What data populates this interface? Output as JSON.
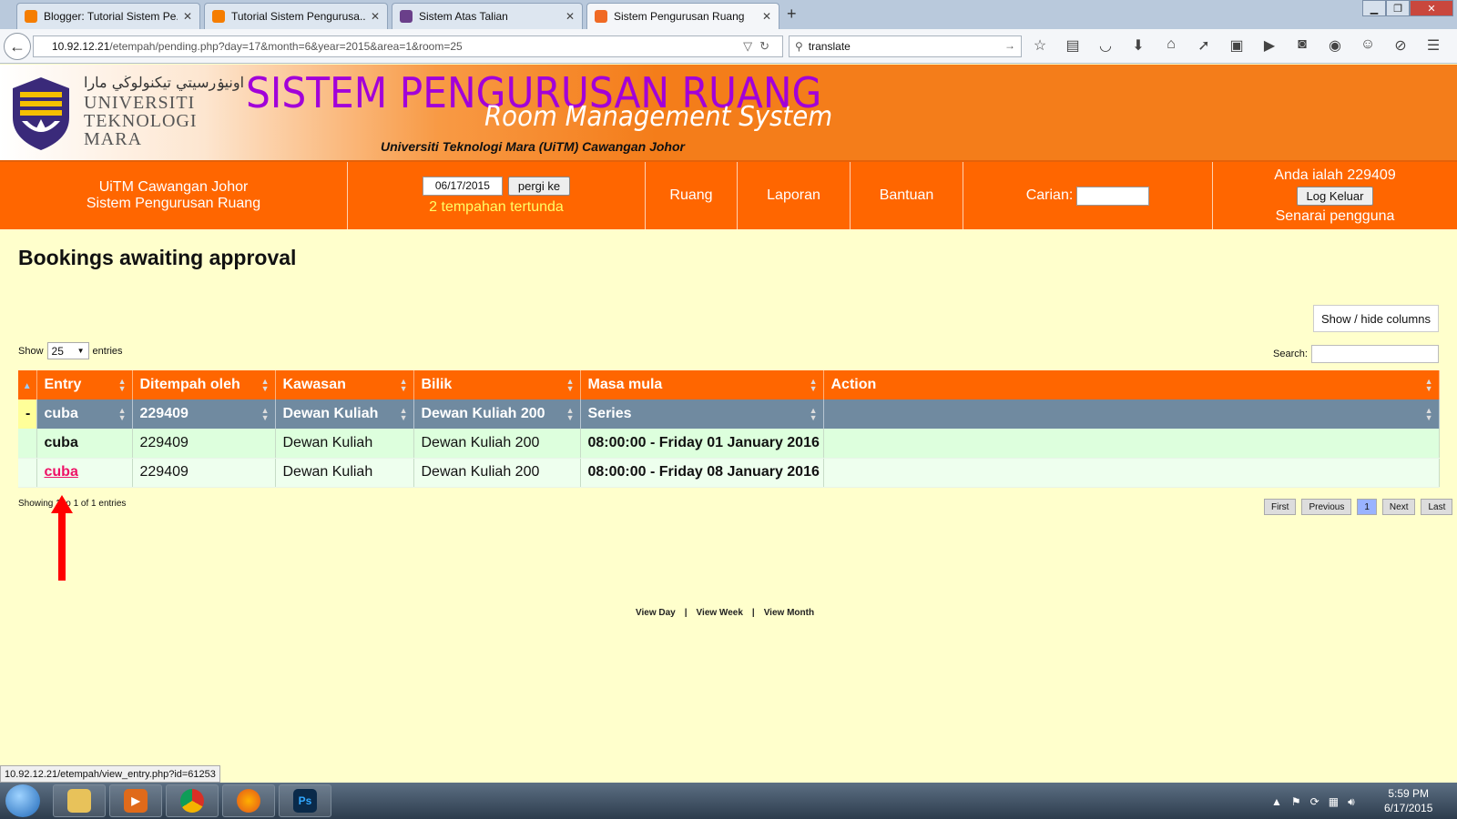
{
  "browser": {
    "tabs": [
      {
        "label": "Blogger: Tutorial Sistem Pe...",
        "color": "#f57d00"
      },
      {
        "label": "Tutorial Sistem Pengurusa...",
        "color": "#f57d00"
      },
      {
        "label": "Sistem Atas Talian",
        "color": "#6a3f8a"
      },
      {
        "label": "Sistem Pengurusan Ruang",
        "color": "#f06a24"
      }
    ],
    "url_host": "10.92.12.21",
    "url_path": "/etempah/pending.php?day=17&month=6&year=2015&area=1&room=25",
    "search_value": "translate",
    "status_link": "10.92.12.21/etempah/view_entry.php?id=61253"
  },
  "banner": {
    "jawi": "اونيۏرسيتي تيكنولوڬي مارا",
    "uni_line1": "UNIVERSITI",
    "uni_line2": "TEKNOLOGI",
    "uni_line3": "MARA",
    "title": "SISTEM PENGURUSAN RUANG",
    "subtitle": "Room Management System",
    "campus": "Universiti Teknologi Mara (UiTM) Cawangan Johor"
  },
  "menu": {
    "org_line1": "UiTM Cawangan Johor",
    "org_line2": "Sistem Pengurusan Ruang",
    "date_value": "06/17/2015",
    "go_label": "pergi ke",
    "pending": "2 tempahan tertunda",
    "ruang": "Ruang",
    "laporan": "Laporan",
    "bantuan": "Bantuan",
    "carian": "Carian:",
    "user_label": "Anda ialah 229409",
    "logout": "Log Keluar",
    "user_list": "Senarai pengguna"
  },
  "page": {
    "title": "Bookings awaiting approval",
    "show_hide": "Show / hide columns",
    "show": "Show",
    "entries_value": "25",
    "entries": "entries",
    "search": "Search:",
    "showing": "Showing 1 to 1 of 1 entries",
    "pager": {
      "first": "First",
      "previous": "Previous",
      "current": "1",
      "next": "Next",
      "last": "Last"
    },
    "footer": {
      "day": "View Day",
      "sep": "|",
      "week": "View Week",
      "month": "View Month"
    }
  },
  "table": {
    "headers": [
      "Entry",
      "Ditempah oleh",
      "Kawasan",
      "Bilik",
      "Masa mula",
      "Action"
    ],
    "group": {
      "toggle": "-",
      "entry": "cuba",
      "by": "229409",
      "area": "Dewan Kuliah",
      "room": "Dewan Kuliah 200",
      "start": "Series"
    },
    "rows": [
      {
        "entry": "cuba",
        "by": "229409",
        "area": "Dewan Kuliah",
        "room": "Dewan Kuliah 200",
        "start": "08:00:00 - Friday 01 January 2016"
      },
      {
        "entry": "cuba",
        "by": "229409",
        "area": "Dewan Kuliah",
        "room": "Dewan Kuliah 200",
        "start": "08:00:00 - Friday 08 January 2016"
      }
    ]
  },
  "taskbar": {
    "ps_label": "Ps",
    "time": "5:59 PM",
    "date": "6/17/2015"
  },
  "colors": {
    "orange": "#ff6600",
    "purple": "#a200d9",
    "background": "#ffffcc",
    "link": "#ee1166"
  }
}
